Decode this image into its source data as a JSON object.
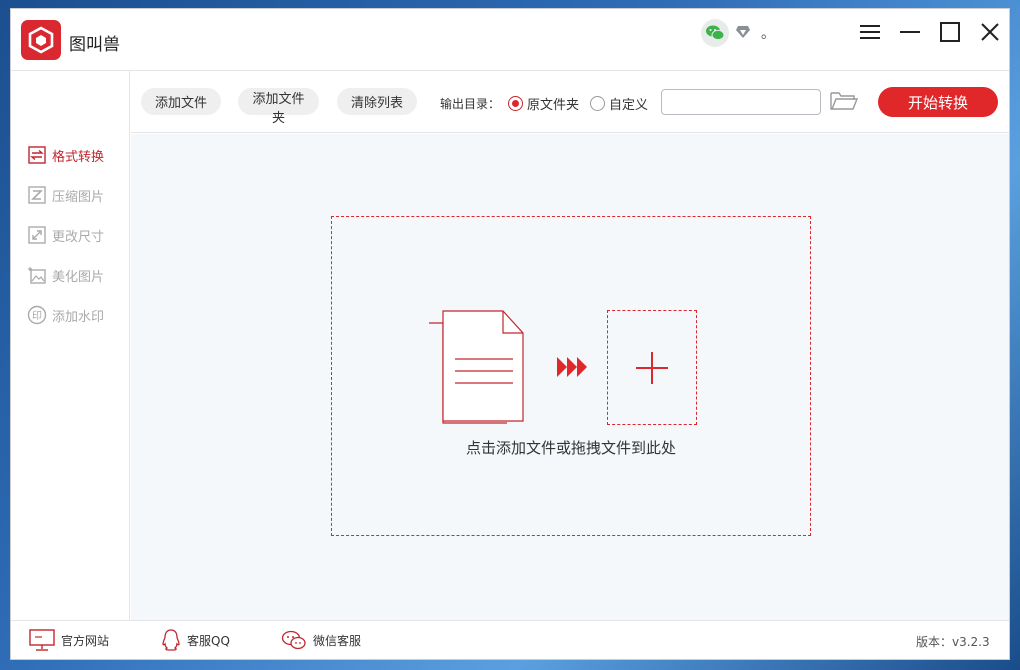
{
  "app": {
    "title": "图叫兽",
    "vip_dot": "。"
  },
  "colors": {
    "accent": "#d9282f",
    "start_button": "#e0282b"
  },
  "sidebar": {
    "items": [
      {
        "label": "格式转换",
        "icon": "format-convert-icon",
        "active": true
      },
      {
        "label": "压缩图片",
        "icon": "compress-icon",
        "active": false
      },
      {
        "label": "更改尺寸",
        "icon": "resize-icon",
        "active": false
      },
      {
        "label": "美化图片",
        "icon": "beautify-icon",
        "active": false
      },
      {
        "label": "添加水印",
        "icon": "watermark-icon",
        "active": false
      }
    ]
  },
  "toolbar": {
    "add_file": "添加文件",
    "add_folder": "添加文件夹",
    "clear_list": "清除列表",
    "output_label": "输出目录：",
    "radio_original": "原文件夹",
    "radio_custom": "自定义",
    "selected_output": "原文件夹",
    "path_value": "",
    "start": "开始转换"
  },
  "main": {
    "drop_text": "点击添加文件或拖拽文件到此处"
  },
  "footer": {
    "website": "官方网站",
    "qq": "客服QQ",
    "wechat": "微信客服",
    "version": "版本：v3.2.3"
  }
}
